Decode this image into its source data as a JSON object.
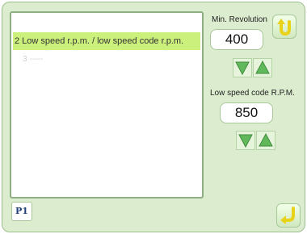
{
  "list": {
    "selected_item": "2 Low speed r.p.m. / low speed code r.p.m.",
    "next_item": "3 -----"
  },
  "min_revolution": {
    "label": "Min. Revolution",
    "value": "400"
  },
  "low_speed_code_rpm": {
    "label": "Low speed code R.P.M.",
    "value": "850"
  },
  "page_tab": {
    "label": "P1"
  },
  "icons": {
    "top_right": "u-turn-arrow-icon",
    "bottom_right": "return-arrow-icon",
    "down": "down-triangle-icon",
    "up": "up-triangle-icon"
  },
  "colors": {
    "background": "#dcedcf",
    "selection": "#ccf07c",
    "accent": "#e8d21a",
    "arrow": "#62b95c"
  }
}
